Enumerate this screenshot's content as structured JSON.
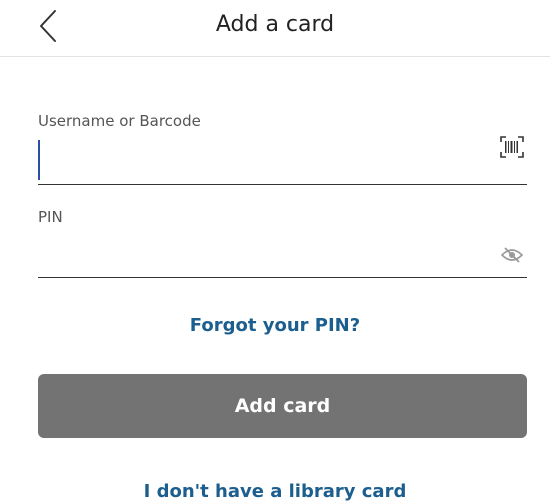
{
  "header": {
    "title": "Add a card",
    "back_icon": "chevron-left-icon"
  },
  "username": {
    "label": "Username or Barcode",
    "value": "",
    "scan_icon": "barcode-scan-icon"
  },
  "pin": {
    "label": "PIN",
    "value": "",
    "visibility_icon": "eye-off-icon"
  },
  "links": {
    "forgot_pin": "Forgot your PIN?",
    "no_card": "I don't have a library card"
  },
  "actions": {
    "add_card_label": "Add card"
  },
  "colors": {
    "link": "#1c5e8e",
    "button_disabled": "#737373",
    "caret": "#2a4fa0",
    "divider": "#e3e3e3"
  }
}
